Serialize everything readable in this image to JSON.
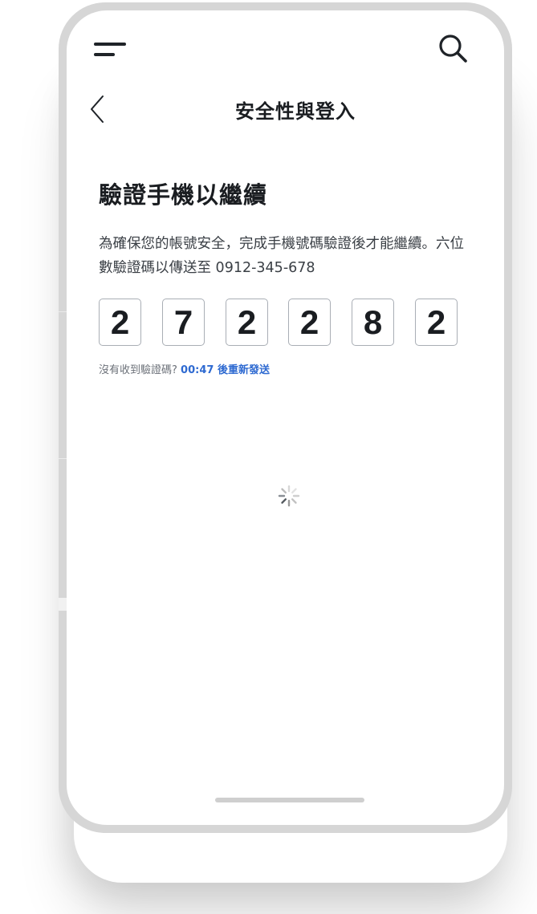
{
  "header": {
    "title": "安全性與登入",
    "menu_icon": "menu-icon",
    "search_icon": "search-icon",
    "back_icon": "chevron-left-icon"
  },
  "content": {
    "heading": "驗證手機以繼續",
    "description": "為確保您的帳號安全，完成手機號碼驗證後才能繼續。六位數驗證碼以傳送至 0912-345-678",
    "code_digits": [
      "2",
      "7",
      "2",
      "2",
      "8",
      "2"
    ],
    "resend_prefix": "沒有收到驗證碼? ",
    "resend_timer": "00:47 後重新發送",
    "loading_icon": "loading-spinner-icon"
  },
  "colors": {
    "accent": "#2e6ad1",
    "text_primary": "#1a1d21",
    "frame": "#d6d6d6"
  }
}
